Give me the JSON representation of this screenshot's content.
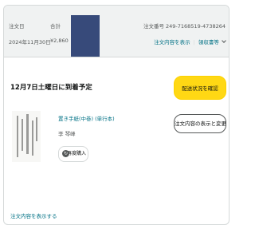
{
  "header": {
    "placed_label": "注文日",
    "placed_value": "2024年11月30日",
    "total_label": "合計",
    "total_value": "¥2,860",
    "order_number_label": "注文番号 249-7168519-4738264",
    "view_details_link": "注文内容を表示",
    "receipt_link": "領収書等"
  },
  "shipment": {
    "delivery_status": "12月7日土曜日に到着予定",
    "track_button": "配送状況を確認",
    "cancel_button": "注文内容の表示と変更"
  },
  "item": {
    "title": "置き手紙(中巻) (単行本)",
    "author": "李 琴峰",
    "rebuy_button": "再度購入",
    "rebuy_icon": "rebuy-icon"
  },
  "footer": {
    "view_order_link": "注文内容を表示する"
  },
  "colors": {
    "header_bg": "#f0f2f2",
    "primary_button": "#ffd814",
    "link": "#007185",
    "redaction": "#374a7a"
  }
}
